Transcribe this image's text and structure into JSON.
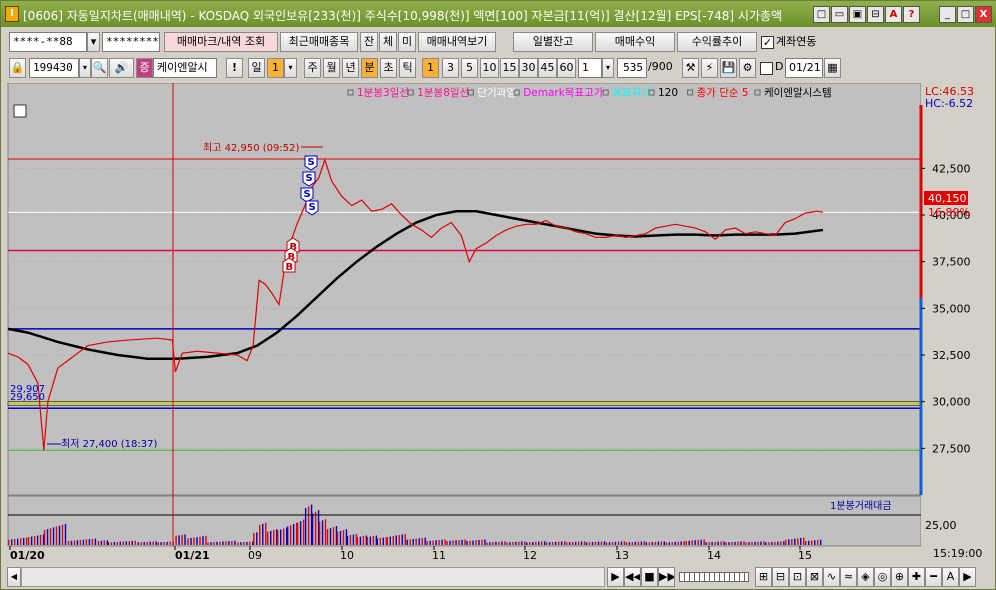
{
  "window": {
    "title": "[0606] 자동일지차트(매매내역) - KOSDAQ 외국인보유[233(천)] 주식수[10,998(천)] 액면[100] 자본금[11(억)] 결산[12월] EPS[-748] 시가총액",
    "app_icon": "I",
    "title_buttons": [
      "□",
      "▭",
      "▣",
      "⊟",
      "A",
      "?",
      "_",
      "□",
      "X"
    ]
  },
  "toolbar1": {
    "account": "****-**88",
    "password": "********",
    "trade_mark_button": "매매마크/내역 조회",
    "recent_items_button": "최근매매종목",
    "jan": "잔",
    "che": "체",
    "mi": "미",
    "history_button": "매매내역보기",
    "daily_balance_button": "일별잔고",
    "trade_profit_button": "매매수익",
    "profit_trend_button": "수익률추이",
    "account_link_label": "계좌연동",
    "account_link_checked": true
  },
  "toolbar2": {
    "code": "199430",
    "search_icon": "search-icon",
    "name": "케이엔알시",
    "exclaim": "!",
    "period": "일",
    "period_value": "1",
    "units": [
      "주",
      "월",
      "년",
      "분",
      "초",
      "틱"
    ],
    "active_unit": "분",
    "minute_options": [
      "1",
      "3",
      "5",
      "10",
      "15",
      "30",
      "45",
      "60"
    ],
    "active_minute": "1",
    "count_value": "1",
    "bars_shown": "535",
    "bars_total": "/900",
    "d_checkbox_label": "D",
    "date_value": "01/21"
  },
  "legend": {
    "items": [
      {
        "text": "1분봉3일선",
        "color": "#ff1493"
      },
      {
        "text": "1분봉8일선",
        "color": "#ff1493"
      },
      {
        "text": "단기과열",
        "color": "#ffffff"
      },
      {
        "text": "Demark목표고가",
        "color": "#ff00ff"
      },
      {
        "text": "목표저가",
        "color": "#00ffff"
      },
      {
        "text": "120",
        "color": "#000000"
      },
      {
        "text": "종가 단순 5",
        "color": "#ff0000"
      },
      {
        "text": "케이엔알시스템",
        "color": "#000000"
      }
    ],
    "volume_legend": "1분봉거래대금"
  },
  "price_axis": {
    "lc": "LC:46.53",
    "hc": "HC:-6.52",
    "ticks": [
      "42,500",
      "40,000",
      "37,500",
      "35,000",
      "32,500",
      "30,000",
      "27,500"
    ],
    "current_price": "40,150",
    "current_change": "16.89%",
    "volume_tick": "25,00",
    "time_display": "15:19:00"
  },
  "annotations": {
    "high_label": "최고 42,950 (09:52)",
    "low_label": "최저 27,400 (18:37)",
    "line_label_1": "29,907",
    "line_label_2": "29,650",
    "sell_marks": [
      "S",
      "S",
      "S",
      "S"
    ],
    "buy_marks": [
      "B",
      "B",
      "B"
    ]
  },
  "x_axis": {
    "labels": [
      "01/20",
      "01/21",
      "09",
      "10",
      "11",
      "12",
      "13",
      "14",
      "15"
    ]
  },
  "chart_data": {
    "type": "line",
    "symbol": "케이엔알시스템",
    "y_range": [
      25000,
      46000
    ],
    "reference_lines": {
      "red_top": 43000,
      "red_mid": 38100,
      "blue_top": 33900,
      "yellow_band": 29907,
      "blue_low": 29650,
      "green_low": 27400
    },
    "price_path": [
      [
        0,
        32600
      ],
      [
        10,
        32400
      ],
      [
        20,
        32000
      ],
      [
        30,
        31000
      ],
      [
        36,
        27400
      ],
      [
        40,
        30000
      ],
      [
        50,
        31800
      ],
      [
        60,
        32200
      ],
      [
        80,
        33000
      ],
      [
        100,
        33200
      ],
      [
        120,
        33300
      ],
      [
        150,
        33400
      ],
      [
        165,
        33300
      ],
      [
        168,
        31600
      ],
      [
        175,
        32600
      ],
      [
        190,
        32700
      ],
      [
        210,
        32600
      ],
      [
        230,
        32500
      ],
      [
        240,
        32200
      ],
      [
        246,
        33000
      ],
      [
        252,
        36500
      ],
      [
        258,
        36300
      ],
      [
        265,
        35800
      ],
      [
        272,
        35200
      ],
      [
        280,
        38000
      ],
      [
        290,
        39500
      ],
      [
        298,
        40500
      ],
      [
        305,
        41500
      ],
      [
        312,
        42000
      ],
      [
        318,
        42950
      ],
      [
        325,
        41800
      ],
      [
        335,
        41000
      ],
      [
        345,
        40500
      ],
      [
        355,
        40800
      ],
      [
        365,
        40200
      ],
      [
        375,
        40300
      ],
      [
        385,
        40600
      ],
      [
        395,
        40000
      ],
      [
        405,
        39500
      ],
      [
        415,
        39200
      ],
      [
        425,
        38800
      ],
      [
        435,
        39300
      ],
      [
        445,
        39600
      ],
      [
        455,
        38900
      ],
      [
        463,
        37500
      ],
      [
        470,
        38200
      ],
      [
        480,
        38500
      ],
      [
        490,
        38900
      ],
      [
        500,
        39200
      ],
      [
        510,
        39400
      ],
      [
        520,
        39500
      ],
      [
        530,
        39500
      ],
      [
        540,
        39700
      ],
      [
        550,
        39400
      ],
      [
        560,
        39300
      ],
      [
        570,
        39100
      ],
      [
        580,
        39000
      ],
      [
        590,
        38800
      ],
      [
        600,
        38800
      ],
      [
        610,
        38900
      ],
      [
        620,
        38800
      ],
      [
        630,
        38900
      ],
      [
        640,
        39000
      ],
      [
        650,
        39300
      ],
      [
        660,
        39400
      ],
      [
        670,
        39500
      ],
      [
        680,
        39400
      ],
      [
        690,
        39300
      ],
      [
        700,
        39100
      ],
      [
        710,
        38700
      ],
      [
        720,
        39200
      ],
      [
        730,
        39300
      ],
      [
        740,
        39000
      ],
      [
        750,
        39100
      ],
      [
        760,
        39000
      ],
      [
        770,
        38900
      ],
      [
        780,
        39600
      ],
      [
        790,
        39800
      ],
      [
        800,
        40100
      ],
      [
        812,
        40200
      ],
      [
        818,
        40150
      ]
    ],
    "ma120_path": [
      [
        0,
        33900
      ],
      [
        20,
        33700
      ],
      [
        50,
        33200
      ],
      [
        80,
        32800
      ],
      [
        110,
        32500
      ],
      [
        140,
        32300
      ],
      [
        170,
        32300
      ],
      [
        200,
        32400
      ],
      [
        230,
        32600
      ],
      [
        250,
        33000
      ],
      [
        270,
        33700
      ],
      [
        290,
        34600
      ],
      [
        310,
        35600
      ],
      [
        330,
        36600
      ],
      [
        350,
        37500
      ],
      [
        370,
        38300
      ],
      [
        390,
        39000
      ],
      [
        410,
        39600
      ],
      [
        430,
        40000
      ],
      [
        450,
        40200
      ],
      [
        470,
        40200
      ],
      [
        490,
        40000
      ],
      [
        510,
        39800
      ],
      [
        530,
        39600
      ],
      [
        550,
        39400
      ],
      [
        570,
        39200
      ],
      [
        590,
        39000
      ],
      [
        610,
        38900
      ],
      [
        630,
        38850
      ],
      [
        650,
        38900
      ],
      [
        670,
        38950
      ],
      [
        690,
        38950
      ],
      [
        710,
        38900
      ],
      [
        730,
        38950
      ],
      [
        750,
        38950
      ],
      [
        770,
        38950
      ],
      [
        790,
        39000
      ],
      [
        818,
        39200
      ]
    ],
    "volume": [
      [
        0,
        0.2
      ],
      [
        20,
        0.3
      ],
      [
        36,
        0.5
      ],
      [
        60,
        0.15
      ],
      [
        100,
        0.1
      ],
      [
        150,
        0.1
      ],
      [
        168,
        0.25
      ],
      [
        200,
        0.1
      ],
      [
        246,
        0.4
      ],
      [
        252,
        0.6
      ],
      [
        260,
        0.5
      ],
      [
        270,
        0.55
      ],
      [
        280,
        0.7
      ],
      [
        290,
        0.85
      ],
      [
        298,
        1.0
      ],
      [
        305,
        0.9
      ],
      [
        312,
        0.7
      ],
      [
        320,
        0.6
      ],
      [
        330,
        0.5
      ],
      [
        340,
        0.35
      ],
      [
        350,
        0.3
      ],
      [
        360,
        0.3
      ],
      [
        370,
        0.25
      ],
      [
        380,
        0.3
      ],
      [
        400,
        0.2
      ],
      [
        420,
        0.15
      ],
      [
        440,
        0.15
      ],
      [
        460,
        0.15
      ],
      [
        480,
        0.1
      ],
      [
        500,
        0.1
      ],
      [
        520,
        0.1
      ],
      [
        540,
        0.1
      ],
      [
        560,
        0.1
      ],
      [
        580,
        0.1
      ],
      [
        600,
        0.1
      ],
      [
        620,
        0.1
      ],
      [
        640,
        0.1
      ],
      [
        660,
        0.1
      ],
      [
        680,
        0.15
      ],
      [
        700,
        0.1
      ],
      [
        720,
        0.1
      ],
      [
        740,
        0.1
      ],
      [
        760,
        0.1
      ],
      [
        780,
        0.2
      ],
      [
        800,
        0.15
      ],
      [
        818,
        0.2
      ]
    ]
  }
}
